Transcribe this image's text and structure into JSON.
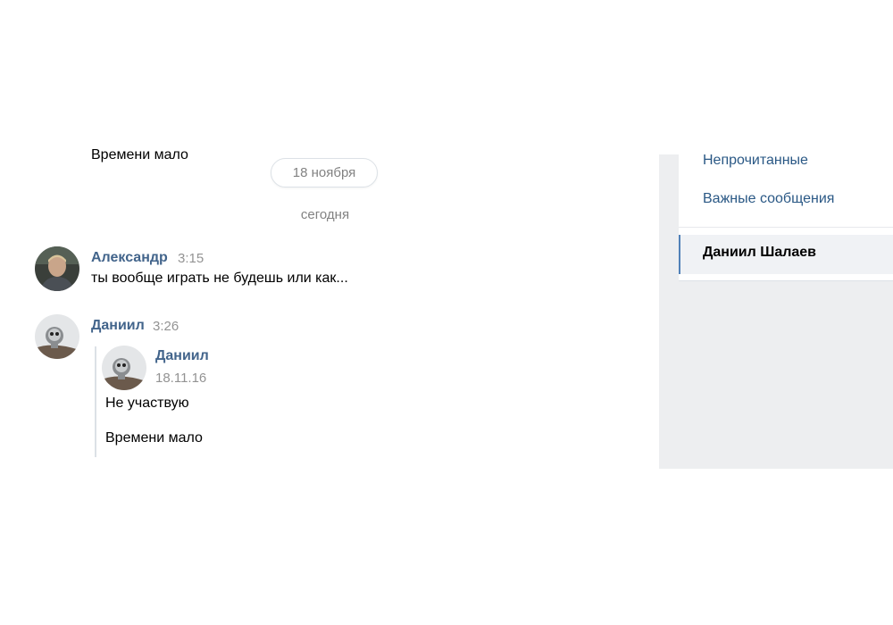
{
  "chat": {
    "previous_message_cut": "Времени мало",
    "date_pill": "18 ноября",
    "today_label": "сегодня",
    "messages": [
      {
        "author": "Александр",
        "time": "3:15",
        "text": "ты вообще играть не будешь или как..."
      },
      {
        "author": "Даниил",
        "time": "3:26",
        "forwarded": {
          "author": "Даниил",
          "date": "18.11.16",
          "lines": [
            "Не участвую",
            "Времени мало"
          ]
        }
      }
    ]
  },
  "sidebar": {
    "unread_label": "Непрочитанные",
    "important_label": "Важные сообщения",
    "selected_conversation": "Даниил Шалаев"
  },
  "colors": {
    "author_link": "#42648b",
    "menu_link": "#2a5885",
    "selection_marker": "#5181b8",
    "panel_bg": "#edeef0"
  },
  "icons": {
    "avatar_alexander": "user-photo",
    "avatar_daniil": "user-photo-mascot"
  }
}
